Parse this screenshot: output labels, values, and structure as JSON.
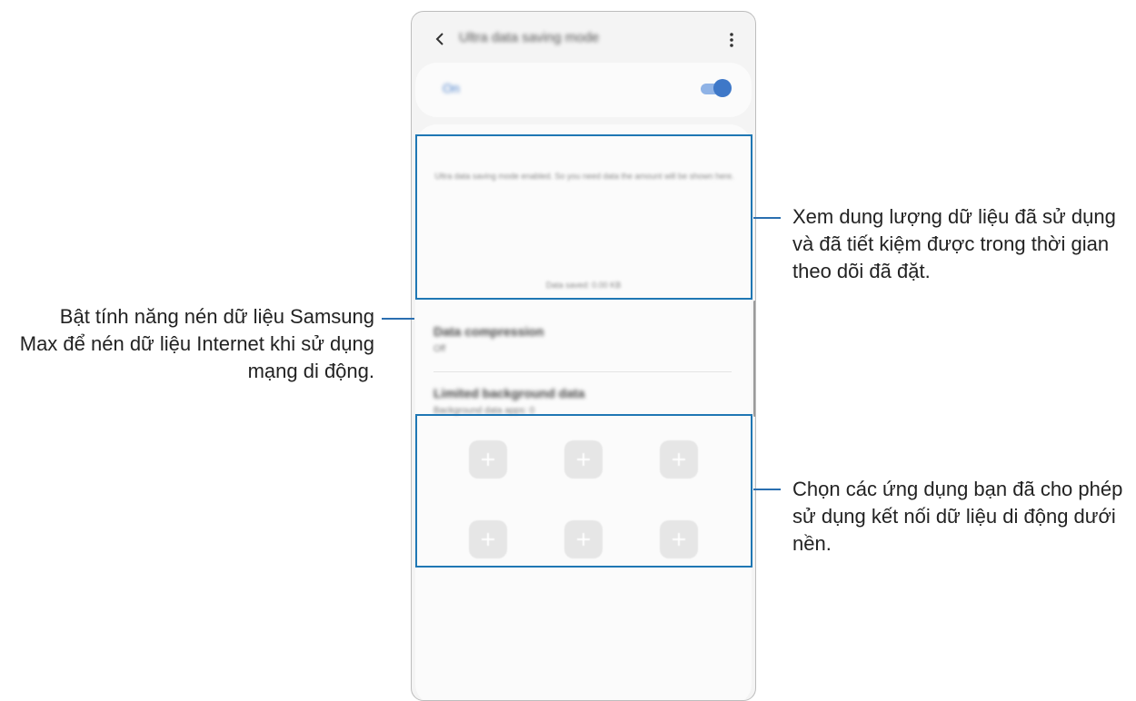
{
  "screen": {
    "title": "Ultra data saving mode",
    "toggle_label": "On",
    "toggle_on": true,
    "notice": "Ultra data saving mode enabled. So you need data the amount will be shown here.",
    "usage_label": "Data saved: 0.00 KB",
    "rows": [
      {
        "title": "Data compression",
        "subtitle": "Off"
      },
      {
        "title": "Limited background data",
        "subtitle": "Background data apps: 0"
      }
    ],
    "app_slot_count": 6
  },
  "callouts": {
    "top_right": "Xem dung lượng dữ liệu đã sử dụng và đã tiết kiệm được trong thời gian theo dõi đã đặt.",
    "left": "Bật tính năng nén dữ liệu Samsung Max để nén dữ liệu Internet khi sử dụng mạng di động.",
    "bottom_right": "Chọn các ứng dụng bạn đã cho phép sử dụng kết nối dữ liệu di động dưới nền."
  },
  "colors": {
    "accent": "#3e78c8",
    "highlight": "#1f77b4"
  }
}
